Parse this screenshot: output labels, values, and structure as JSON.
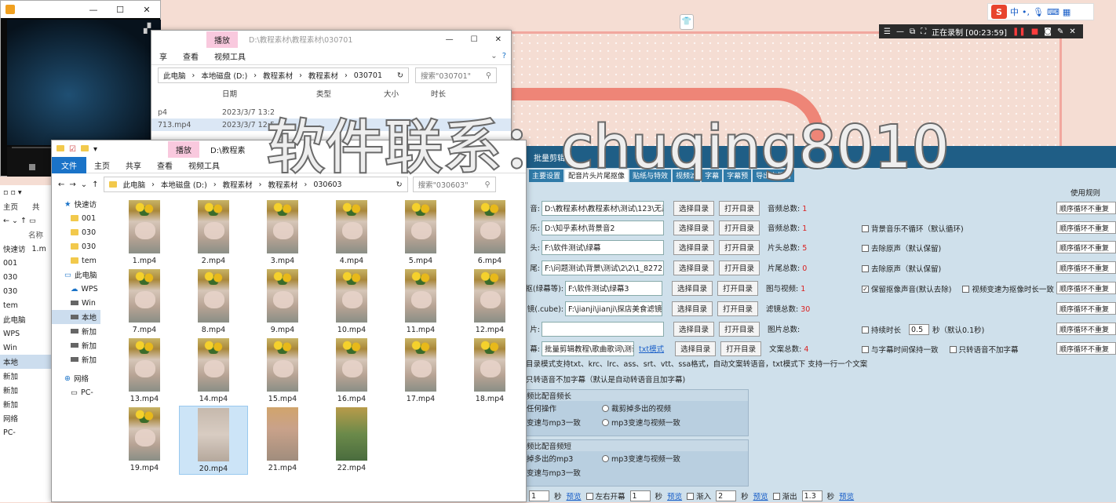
{
  "tray": {
    "logo": "S",
    "lang": "中",
    "punct": "•,",
    "mic": "🎙",
    "keyboard": "⌨",
    "shirt": "👕",
    "grid": "▦"
  },
  "recorder": {
    "status": "正在录制 [00:23:59]"
  },
  "player": {
    "title_controls": [
      "—",
      "☐",
      "✕"
    ]
  },
  "explorer_back": {
    "title_path": "D:\\教程素材\\教程素材\\030701",
    "ribbon_accent": "播放",
    "tabs": [
      "享",
      "查看",
      "视频工具"
    ],
    "breadcrumb": [
      "此电脑",
      "本地磁盘 (D:)",
      "教程素材",
      "教程素材",
      "030701"
    ],
    "search_placeholder": "搜索\"030701\"",
    "columns": [
      "日期",
      "类型",
      "大小",
      "时长"
    ],
    "rows": [
      {
        "name": "p4",
        "date": "2023/3/7 13:2"
      },
      {
        "name": "713.mp4",
        "date": "2023/3/7 12:5"
      }
    ]
  },
  "explorer_front": {
    "title_path": "D:\\教程素",
    "ribbon_accent": "播放",
    "tabs": [
      "文件",
      "主页",
      "共享",
      "查看",
      "视频工具"
    ],
    "breadcrumb": [
      "此电脑",
      "本地磁盘 (D:)",
      "教程素材",
      "教程素材",
      "030603"
    ],
    "search_placeholder": "搜索\"030603\"",
    "sidebar": [
      "快速访",
      "001",
      "030",
      "030",
      "tem",
      "此电脑",
      "WPS",
      "Win",
      "本地",
      "新加",
      "新加",
      "新加",
      "网络",
      "PC-"
    ],
    "files": [
      "1.mp4",
      "2.mp4",
      "3.mp4",
      "4.mp4",
      "5.mp4",
      "6.mp4",
      "7.mp4",
      "8.mp4",
      "9.mp4",
      "10.mp4",
      "11.mp4",
      "12.mp4",
      "13.mp4",
      "14.mp4",
      "15.mp4",
      "16.mp4",
      "17.mp4",
      "18.mp4",
      "19.mp4",
      "20.mp4",
      "21.mp4",
      "22.mp4"
    ]
  },
  "explorer_left": {
    "items": [
      "主页",
      "共",
      "快速访",
      "001",
      "030",
      "030",
      "tem",
      "此电脑",
      "WPS",
      "Win",
      "本地",
      "新加",
      "新加",
      "新加",
      "网络",
      "PC-"
    ],
    "file": "1.m",
    "col": "名称"
  },
  "app": {
    "header": "批量剪辑",
    "tabs": [
      "主要设置",
      "配音片头片尾抠像",
      "贴纸与特效",
      "视频滤",
      "字幕",
      "字幕预",
      "导出文件名"
    ],
    "rule_header": "使用规则",
    "rows": [
      {
        "label": "音:",
        "path": "D:\\教程素材\\教程素材\\测试\\123\\无声\\",
        "stat_label": "音频总数:",
        "stat": "1"
      },
      {
        "label": "乐:",
        "path": "D:\\知乎素材\\背景音2",
        "stat_label": "音频总数:",
        "stat": "1",
        "option": "背景音乐不循环（默认循环)"
      },
      {
        "label": "头:",
        "path": "F:\\软件测试\\绿幕",
        "stat_label": "片头总数:",
        "stat": "5",
        "option": "去除原声（默认保留)"
      },
      {
        "label": "尾:",
        "path": "F:\\问题测试\\背景\\测试\\2\\2\\1_8272.mp",
        "stat_label": "片尾总数:",
        "stat": "0",
        "option": "去除原声（默认保留)"
      },
      {
        "label": "抠(绿幕等):",
        "path": "F:\\软件测试\\绿幕3",
        "stat_label": "图与视频:",
        "stat": "1",
        "option": "保留抠像声音(默认去除)",
        "option2": "视频变速为抠像时长一致"
      },
      {
        "label": "镜(.cube):",
        "path": "F:\\jianji\\jianji\\探店美食滤镜",
        "stat_label": "滤镜总数:",
        "stat": "30"
      },
      {
        "label": "片:",
        "path": "",
        "stat_label": "图片总数:",
        "stat": "",
        "option": "持续时长",
        "dur": "0.5",
        "dur_unit": "秒（默认0.1秒)"
      },
      {
        "label": "幕:",
        "path": "批量剪辑教程\\歌曲歌词\\测试",
        "link": "txt模式",
        "stat_label": "文案总数:",
        "stat": "4",
        "option": "与字幕时间保持一致",
        "option2": "只转语音不加字幕"
      }
    ],
    "btn_select": "选择目录",
    "btn_open": "打开目录",
    "rule_option": "顺序循环不重复",
    "note1": "目录模式支持txt、krc、lrc、ass、srt、vtt、ssa格式，自动文案转语音，txt模式下 支持一行一个文案",
    "note2": "只转语音不加字幕（默认是自动转语音且加字幕)",
    "group1": {
      "title": "频比配音频长",
      "r1": "任何操作",
      "r1b": "裁剪掉多出的视频",
      "r2": "变速与mp3一致",
      "r2b": "mp3变速与视频一致"
    },
    "group2": {
      "title": "频比配音频短",
      "r1": "掉多出的mp3",
      "r1b": "mp3变速与视频一致",
      "r2": "变速与mp3一致"
    },
    "bottom": {
      "v1": "1",
      "u1": "秒",
      "p1": "预览",
      "c1": "左右开幕",
      "v2": "1",
      "u2": "秒",
      "p2": "预览",
      "c2": "渐入",
      "v3": "2",
      "u3": "秒",
      "p3": "预览",
      "c3": "渐出",
      "v4": "1.3",
      "u4": "秒",
      "p4": "预览"
    }
  },
  "watermark": "软件联系：chuqing8010"
}
